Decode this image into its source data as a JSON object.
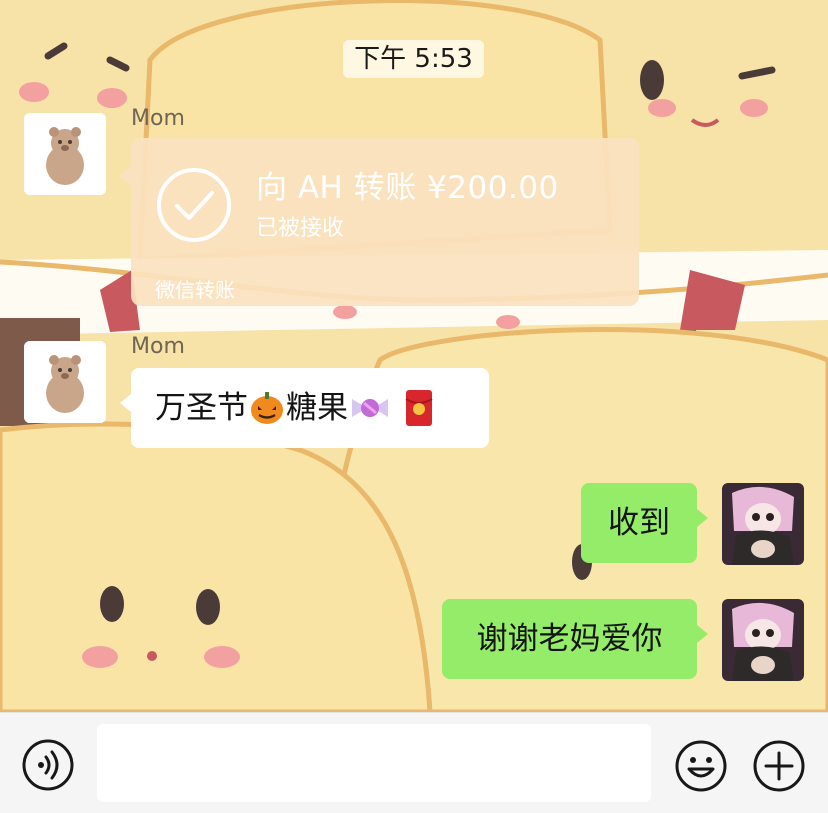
{
  "chat": {
    "timestamp": "下午 5:53",
    "messages": [
      {
        "sender": "Mom",
        "type": "transfer",
        "title": "向 AH 转账 ¥200.00",
        "status": "已被接收",
        "footer": "微信转账"
      },
      {
        "sender": "Mom",
        "type": "text",
        "parts": [
          "万圣节",
          "糖果"
        ],
        "emojis": [
          "pumpkin-icon",
          "candy-icon",
          "red-envelope-icon"
        ]
      },
      {
        "sender": "me",
        "type": "text",
        "text": "收到"
      },
      {
        "sender": "me",
        "type": "text",
        "text": "谢谢老妈爱你"
      }
    ]
  },
  "icons": {
    "voice": "voice-icon",
    "emoji": "smiley-icon",
    "plus": "plus-icon"
  },
  "colors": {
    "wallpaper": "#f7e2a8",
    "outgoing_bubble": "#95ec69",
    "incoming_bubble": "#ffffff",
    "transfer_card": "#fbe2c0"
  }
}
